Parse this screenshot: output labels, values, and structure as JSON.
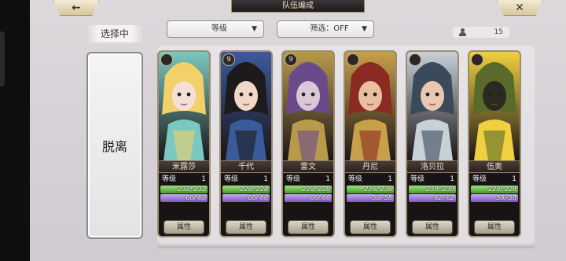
{
  "header": {
    "title": "队伍编成",
    "back_symbol": "←",
    "close_symbol": "✕"
  },
  "side": {
    "select_label": "选择中",
    "leave_label": "脱离"
  },
  "filters": {
    "sort": {
      "label": "等级",
      "caret": "▼"
    },
    "filter": {
      "label": "筛选：OFF",
      "caret": "▼"
    }
  },
  "party_count": "15",
  "cards": [
    {
      "name": "米露莎",
      "level_label": "等级",
      "level": "1",
      "hp": "232/ 232",
      "hp_ratio": 1.0,
      "sp": "60/ 60",
      "sp_ratio": 1.0,
      "attr_label": "属性",
      "badge": "",
      "palette": [
        "#f2d16a",
        "#7ac8c0",
        "#f4e0d8"
      ]
    },
    {
      "name": "千代",
      "level_label": "等级",
      "level": "1",
      "hp": "228/ 228",
      "hp_ratio": 1.0,
      "sp": "66/ 66",
      "sp_ratio": 1.0,
      "attr_label": "属性",
      "badge": "9",
      "palette": [
        "#1e1a1c",
        "#3a5a9a",
        "#f0d8c8"
      ]
    },
    {
      "name": "雷文",
      "level_label": "等级",
      "level": "1",
      "hp": "228/ 228",
      "hp_ratio": 1.0,
      "sp": "66/ 66",
      "sp_ratio": 1.0,
      "attr_label": "属性",
      "badge": "9",
      "palette": [
        "#6a4a8a",
        "#b89a4a",
        "#d8c8d8"
      ]
    },
    {
      "name": "丹尼",
      "level_label": "等级",
      "level": "1",
      "hp": "236/ 236",
      "hp_ratio": 1.0,
      "sp": "58/ 58",
      "sp_ratio": 1.0,
      "attr_label": "属性",
      "badge": "",
      "palette": [
        "#8a2a22",
        "#c8a04a",
        "#e8c0a0"
      ]
    },
    {
      "name": "洛贝拉",
      "level_label": "等级",
      "level": "1",
      "hp": "230/ 230",
      "hp_ratio": 1.0,
      "sp": "62/ 62",
      "sp_ratio": 1.0,
      "attr_label": "属性",
      "badge": "",
      "palette": [
        "#3a4a5a",
        "#c8d0d8",
        "#e8c8b0"
      ]
    },
    {
      "name": "伍奥",
      "level_label": "等级",
      "level": "1",
      "hp": "228/ 228",
      "hp_ratio": 1.0,
      "sp": "58/ 58",
      "sp_ratio": 1.0,
      "attr_label": "属性",
      "badge": "",
      "palette": [
        "#5a6a2a",
        "#f0d040",
        "#2a2a20"
      ]
    }
  ],
  "colors": {
    "hp_bar": "#6cc048",
    "sp_bar": "#9a7ad8",
    "card_border": "#9d8c72",
    "background": "#d6d2d6"
  }
}
